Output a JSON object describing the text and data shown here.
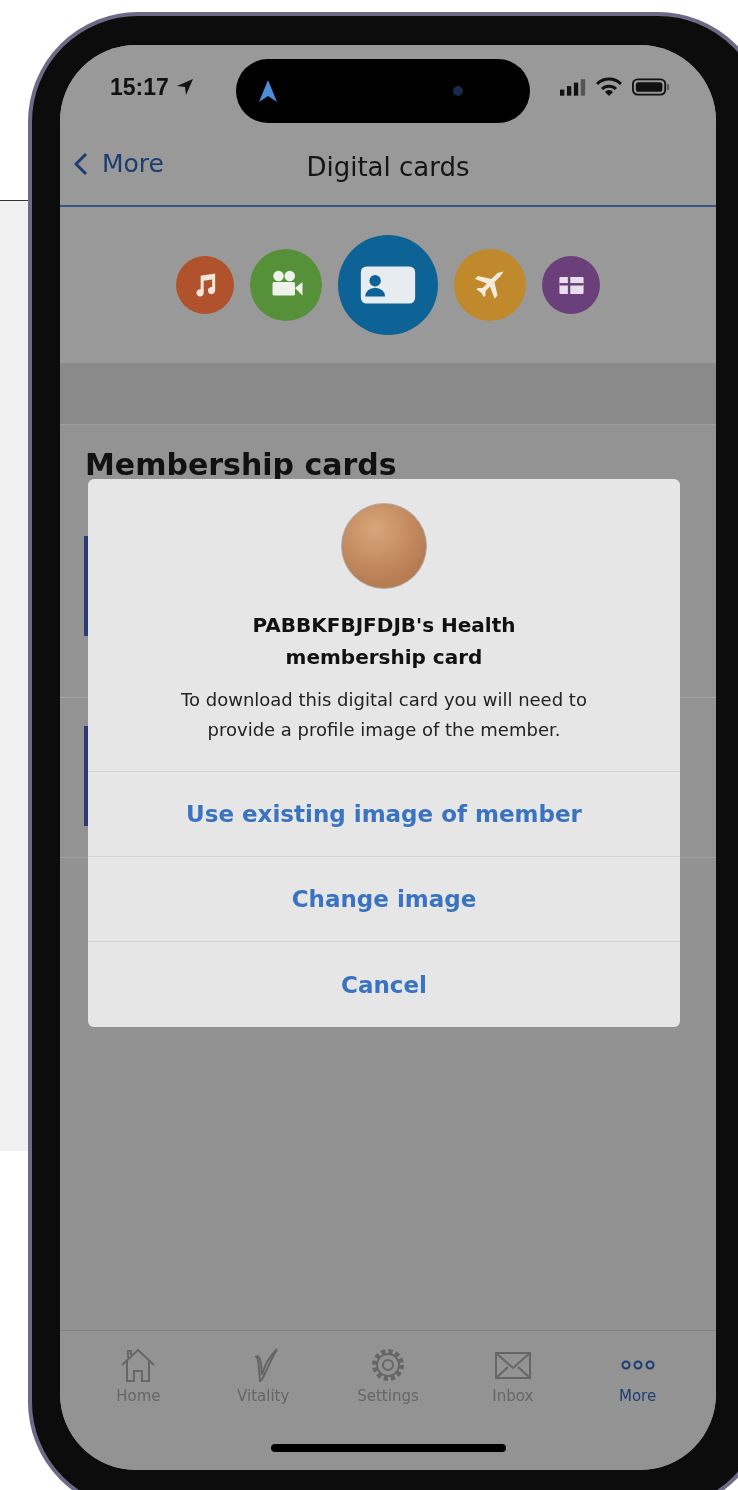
{
  "status_bar": {
    "time": "15:17"
  },
  "nav": {
    "back": "More",
    "title": "Digital cards"
  },
  "categories": [
    {
      "kind": "music",
      "color": "#b0532c",
      "selected": false
    },
    {
      "kind": "video",
      "color": "#56913a",
      "selected": false
    },
    {
      "kind": "id-card",
      "color": "#0d6396",
      "selected": true
    },
    {
      "kind": "plane",
      "color": "#c08a2c",
      "selected": false
    },
    {
      "kind": "gift",
      "color": "#6a3f7a",
      "selected": false
    }
  ],
  "section": {
    "title": "Membership cards"
  },
  "dialog": {
    "title": "PABBKFBJFDJB's Health membership card",
    "message": "To download this digital card you will need to provide a profile image of the member.",
    "actions": [
      "Use existing image of member",
      "Change image",
      "Cancel"
    ]
  },
  "tabs": [
    {
      "kind": "home",
      "label": "Home",
      "selected": false
    },
    {
      "kind": "vitality",
      "label": "Vitality",
      "selected": false
    },
    {
      "kind": "settings",
      "label": "Settings",
      "selected": false
    },
    {
      "kind": "inbox",
      "label": "Inbox",
      "selected": false
    },
    {
      "kind": "more",
      "label": "More",
      "selected": true
    }
  ]
}
